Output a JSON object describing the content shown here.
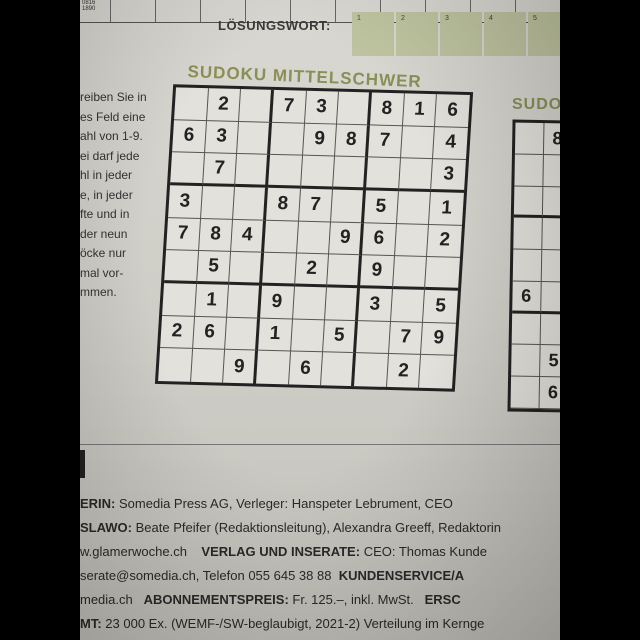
{
  "lottery": {
    "label": "LÖSUNGSWORT:",
    "cells": [
      "1",
      "2",
      "3",
      "4",
      "5"
    ],
    "tiny_header": "0816 1890"
  },
  "instructions": [
    "reiben Sie in",
    "es Feld eine",
    "ahl von 1-9.",
    "ei darf jede",
    "hl in jeder",
    "e, in jeder",
    "fte und in",
    "der neun",
    "öcke nur",
    "mal vor-",
    "mmen."
  ],
  "sudoku": {
    "title": "SUDOKU MITTELSCHWER",
    "second_title": "SUDO",
    "grid": [
      [
        "",
        "2",
        "",
        "7",
        "3",
        "",
        "8",
        "1",
        "6"
      ],
      [
        "6",
        "3",
        "",
        "",
        "9",
        "8",
        "7",
        "",
        "4"
      ],
      [
        "",
        "7",
        "",
        "",
        "",
        "",
        "",
        "",
        "3"
      ],
      [
        "3",
        "",
        "",
        "8",
        "7",
        "",
        "5",
        "",
        "1"
      ],
      [
        "7",
        "8",
        "4",
        "",
        "",
        "9",
        "6",
        "",
        "2"
      ],
      [
        "",
        "5",
        "",
        "",
        "2",
        "",
        "9",
        "",
        ""
      ],
      [
        "",
        "1",
        "",
        "9",
        "",
        "",
        "3",
        "",
        "5"
      ],
      [
        "2",
        "6",
        "",
        "1",
        "",
        "5",
        "",
        "7",
        "9"
      ],
      [
        "",
        "",
        "9",
        "",
        "6",
        "",
        "",
        "2",
        ""
      ]
    ],
    "second_grid": [
      [
        "",
        "8"
      ],
      [
        "",
        ""
      ],
      [
        "",
        ""
      ],
      [
        "",
        ""
      ],
      [
        "",
        ""
      ],
      [
        "6",
        ""
      ],
      [
        "",
        ""
      ],
      [
        "",
        "5"
      ],
      [
        "",
        "6"
      ]
    ]
  },
  "imprint": {
    "line1_label": "ERIN:",
    "line1_text": "Somedia Press AG, Verleger: Hanspeter Lebrument, CEO",
    "line2_label": "SLAWO:",
    "line2_text": "Beate Pfeifer (Redaktionsleitung), Alexandra Greeff, Redaktorin",
    "line3_text": "w.glamerwoche.ch",
    "line3_label": "VERLAG UND INSERATE:",
    "line3_text2": "CEO: Thomas Kunde",
    "line4_text": "serate@somedia.ch, Telefon 055 645 38 88",
    "line4_label": "KUNDENSERVICE/A",
    "line5_text": "media.ch",
    "line5_label": "ABONNEMENTSPREIS:",
    "line5_text2": "Fr. 125.–, inkl. MwSt.",
    "line5_label2": "ERSC",
    "line6_label": "MT:",
    "line6_text": "23 000 Ex. (WEMF-/SW-beglaubigt, 2021-2) Verteilung im Kernge"
  }
}
